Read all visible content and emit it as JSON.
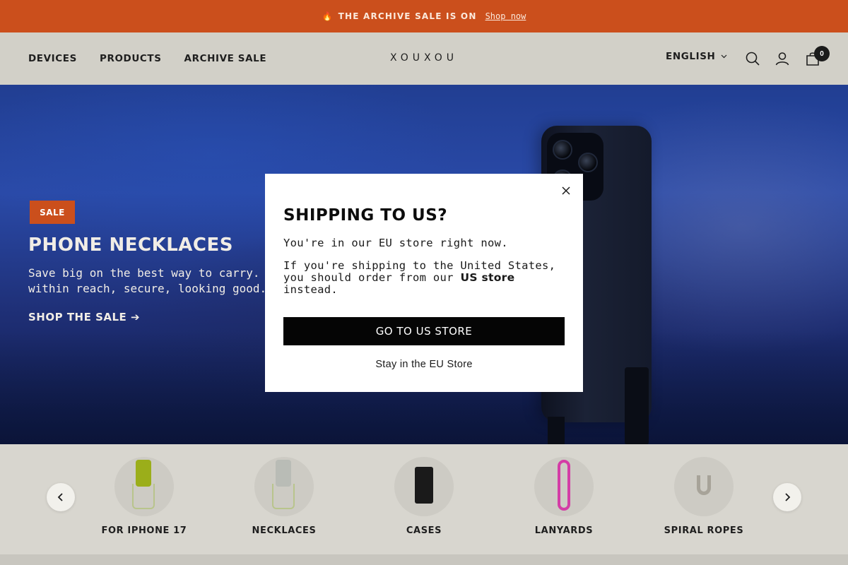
{
  "announcement": {
    "icon": "flame-icon",
    "message": "THE ARCHIVE SALE IS ON",
    "link": "Shop now"
  },
  "header": {
    "nav": [
      "DEVICES",
      "PRODUCTS",
      "ARCHIVE SALE"
    ],
    "logo": "XOUXOU",
    "language": "ENGLISH",
    "cart_count": "0"
  },
  "hero": {
    "badge": "SALE",
    "title": "PHONE NECKLACES",
    "text": "Save big on the best way to carry. Always within reach, secure, looking good.",
    "cta": "SHOP THE SALE ➔"
  },
  "modal": {
    "title": "SHIPPING TO US?",
    "line1": "You're in our EU store right now.",
    "line2a": "If you're shipping to the United States,",
    "line2b": "you should order from our",
    "line2_strong": "US store",
    "line2c": "instead.",
    "button": "GO TO US STORE",
    "secondary": "Stay in the EU Store"
  },
  "categories": [
    {
      "label": "FOR IPHONE 17",
      "color": "#9bae1a"
    },
    {
      "label": "NECKLACES",
      "color": "#b9bcb6"
    },
    {
      "label": "CASES",
      "color": "#1a1a1a"
    },
    {
      "label": "LANYARDS",
      "color": "#d43ca6"
    },
    {
      "label": "SPIRAL ROPES",
      "color": "#a7a399"
    }
  ],
  "colors": {
    "accent": "#cb4f1c",
    "header_bg": "#d2d0c8",
    "button_bg": "#050505"
  }
}
